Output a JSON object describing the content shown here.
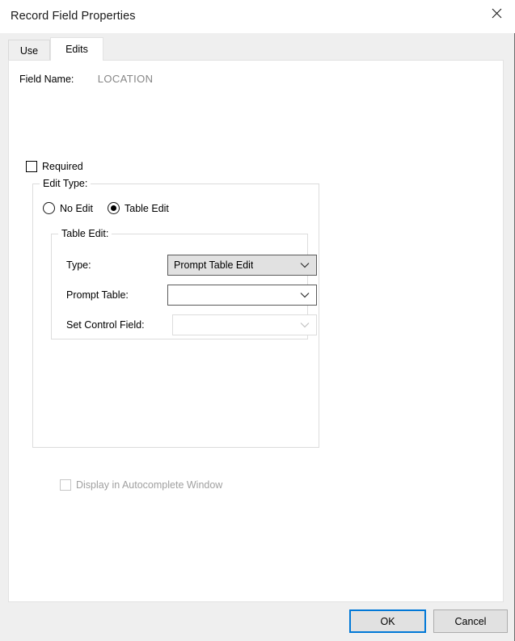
{
  "window": {
    "title": "Record Field Properties",
    "close_icon": "close-icon"
  },
  "tabs": [
    {
      "label": "Use",
      "selected": false
    },
    {
      "label": "Edits",
      "selected": true
    }
  ],
  "edits_tab": {
    "field_name_label": "Field Name:",
    "field_name_value": "LOCATION",
    "required": {
      "label": "Required",
      "checked": false,
      "enabled": true
    },
    "edit_type_group": {
      "title": "Edit Type:",
      "radios": [
        {
          "label": "No Edit",
          "selected": false
        },
        {
          "label": "Table Edit",
          "selected": true
        }
      ],
      "table_edit_group": {
        "title": "Table Edit:",
        "rows": [
          {
            "label": "Type:",
            "value": "Prompt Table Edit",
            "enabled": true,
            "filled": true
          },
          {
            "label": "Prompt Table:",
            "value": "",
            "enabled": true,
            "filled": false
          },
          {
            "label": "Set Control Field:",
            "value": "",
            "enabled": false,
            "filled": false
          }
        ]
      },
      "autocomplete": {
        "label": "Display in Autocomplete Window",
        "checked": false,
        "enabled": false
      }
    }
  },
  "footer": {
    "ok_label": "OK",
    "cancel_label": "Cancel"
  },
  "colors": {
    "accent": "#0078d7",
    "window_bg": "#efefef",
    "panel_bg": "#ffffff",
    "control_bg": "#e1e1e1",
    "disabled_text": "#a0a0a0",
    "readonly_text": "#868686"
  }
}
